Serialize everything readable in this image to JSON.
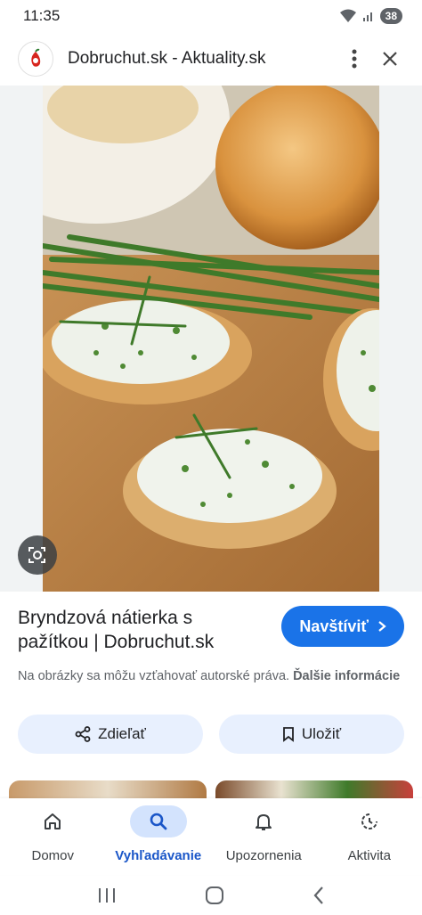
{
  "status": {
    "time": "11:35",
    "battery": "38"
  },
  "header": {
    "site_title": "Dobruchut.sk - Aktuality.sk"
  },
  "result": {
    "title": "Bryndzová nátierka s pažítkou | Dobruchut.sk",
    "visit_label": "Navštíviť",
    "copyright_text": "Na obrázky sa môžu vzťahovať autorské práva.",
    "more_info_label": "Ďalšie informácie"
  },
  "actions": {
    "share_label": "Zdieľať",
    "save_label": "Uložiť"
  },
  "nav": {
    "items": [
      {
        "label": "Domov",
        "icon": "home-icon"
      },
      {
        "label": "Vyhľadávanie",
        "icon": "search-icon"
      },
      {
        "label": "Upozornenia",
        "icon": "bell-icon"
      },
      {
        "label": "Aktivita",
        "icon": "activity-icon"
      }
    ],
    "active": "Vyhľadávanie"
  },
  "colors": {
    "accent": "#1a73e8",
    "pill_bg": "#e8f0fe",
    "active_nav_bg": "#d3e3fd"
  }
}
